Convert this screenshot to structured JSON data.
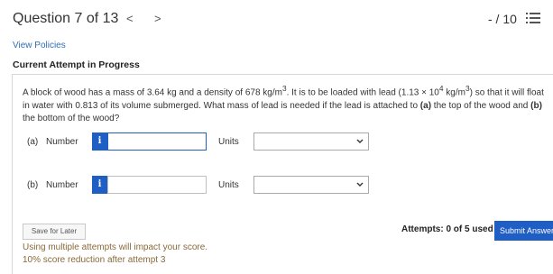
{
  "header": {
    "question_title": "Question 7 of 13",
    "prev_glyph": "<",
    "next_glyph": ">",
    "score": "- / 10"
  },
  "links": {
    "view_policies": "View Policies"
  },
  "attempt_heading": "Current Attempt in Progress",
  "question": {
    "p1": "A block of wood has a mass of 3.64 kg and a density of 678 kg/m",
    "p1_sup": "3",
    "p2": ". It is to be loaded with lead (1.13 × 10",
    "p2_sup": "4",
    "p3": " kg/m",
    "p3_sup": "3",
    "p4": ") so that it will float in water with 0.813 of its volume submerged. What mass of lead is needed if the lead is attached to ",
    "part_a": "(a)",
    "p5": " the top of the wood and ",
    "part_b": "(b)",
    "p6": " the bottom of the wood?"
  },
  "rows": {
    "a": {
      "label": "(a)",
      "number_label": "Number",
      "info_glyph": "i",
      "value": "",
      "units_label": "Units",
      "units_selected": ""
    },
    "b": {
      "label": "(b)",
      "number_label": "Number",
      "info_glyph": "i",
      "value": "",
      "units_label": "Units",
      "units_selected": ""
    }
  },
  "footer": {
    "save_later": "Save for Later",
    "attempts": "Attempts: 0 of 5 used",
    "submit": "Submit Answer",
    "note1": "Using multiple attempts will impact your score.",
    "note2": "10% score reduction after attempt 3"
  },
  "colors": {
    "accent": "#1f5ec4",
    "link": "#2f6fb3",
    "note": "#8a6a3a"
  },
  "icons": {
    "list": "list-icon",
    "info": "info-icon",
    "dropdown": "chevron-down-icon"
  }
}
